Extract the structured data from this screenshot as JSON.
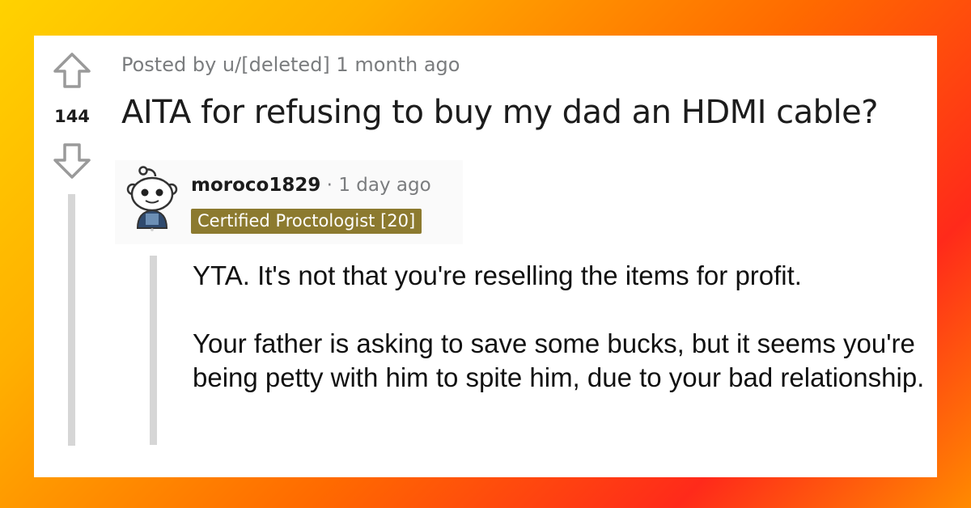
{
  "post": {
    "posted_prefix": "Posted by ",
    "author": "u/[deleted]",
    "time": " 1 month ago",
    "score": "144",
    "title": "AITA for refusing to buy my dad an HDMI cable?"
  },
  "comment": {
    "author": "moroco1829",
    "separator": " · ",
    "time": "1 day ago",
    "flair": "Certified Proctologist [20]",
    "paragraphs": [
      "YTA. It's not that you're reselling the items for profit.",
      "Your father is asking to save some bucks, but it seems you're being petty with him to spite him, due to your bad relationship."
    ]
  },
  "colors": {
    "flair_bg": "#8c7a2f",
    "muted_text": "#7a7c7e",
    "thread_line": "#d6d6d6"
  },
  "icons": [
    "upvote-arrow-icon",
    "downvote-arrow-icon",
    "snoo-avatar-icon"
  ]
}
